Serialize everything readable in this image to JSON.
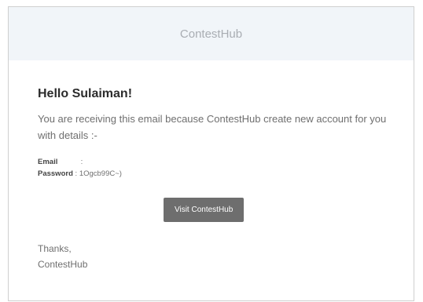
{
  "email": {
    "brand": "ContestHub",
    "greeting": "Hello Sulaiman!",
    "intro": "You are receiving this email because ContestHub create new account for you with details :-",
    "details": {
      "email_label": "Email",
      "email_separator": ":",
      "email_value": "",
      "password_label": "Password",
      "password_separator": ":",
      "password_value": "1Ogcb99C~)"
    },
    "button_label": "Visit ContestHub",
    "closing": "Thanks,",
    "signature": "ContestHub"
  }
}
